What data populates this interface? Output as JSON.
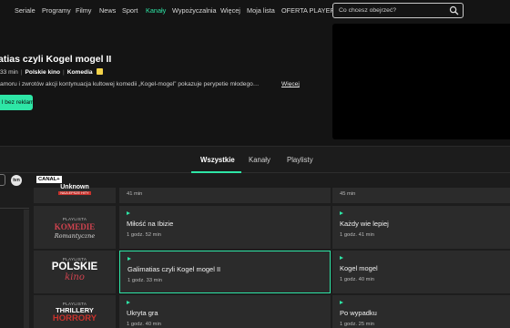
{
  "nav": {
    "items": [
      "Seriale",
      "Programy",
      "Filmy",
      "News",
      "Sport",
      "Kanały",
      "Wypożyczalnia",
      "Więcej",
      "Moja lista",
      "OFERTA PLAYER"
    ],
    "active": "Kanały",
    "search_placeholder": "Co chcesz obejrzeć?",
    "search_icon": "search-icon"
  },
  "hero": {
    "title": "atias czyli Kogel mogel II",
    "duration": "33 min",
    "channel": "Polskie kino",
    "genre": "Komedia",
    "description": "amoru i zwrotów akcji kontynuacja kultowej komedii „Kogel-mogel” pokazuje perypetie młodego…",
    "more_link": "Więcej",
    "button_label": "l bez reklam"
  },
  "tabs": [
    "Wszystkie",
    "Kanały",
    "Playlisty"
  ],
  "active_tab": "Wszystkie",
  "channels": {
    "tvn": "tvn",
    "canal": "CANAL+"
  },
  "playlists": [
    {
      "tag": "",
      "main": "Unknown",
      "sub": "NAJLEPSZE HITY",
      "programs": [
        {
          "title": "",
          "duration": "41 min"
        },
        {
          "title": "",
          "duration": "45 min"
        }
      ]
    },
    {
      "tag": "PLAYLISTA",
      "main": "KOMEDIE",
      "sub": "Romantyczne",
      "programs": [
        {
          "title": "Miłość na Ibizie",
          "duration": "1 godz. 52 min"
        },
        {
          "title": "Każdy wie lepiej",
          "duration": "1 godz. 41 min"
        }
      ]
    },
    {
      "tag": "PLAYLISTA",
      "main": "POLSKIE",
      "sub": "kino",
      "programs": [
        {
          "title": "Galimatias czyli Kogel mogel II",
          "duration": "1 godz. 33 min"
        },
        {
          "title": "Kogel mogel",
          "duration": "1 godz. 40 min"
        }
      ]
    },
    {
      "tag": "PLAYLISTA",
      "main": "THRILLERY",
      "sub": "HORRORY",
      "programs": [
        {
          "title": "Ukryta gra",
          "duration": "1 godz. 40 min"
        },
        {
          "title": "Po wypadku",
          "duration": "1 godz. 25 min"
        }
      ]
    }
  ],
  "colors": {
    "accent": "#2ee6a6",
    "background": "#141414",
    "card": "#2b2b2b",
    "komedie": "#d0434f",
    "thrillery_red": "#c8322c"
  }
}
